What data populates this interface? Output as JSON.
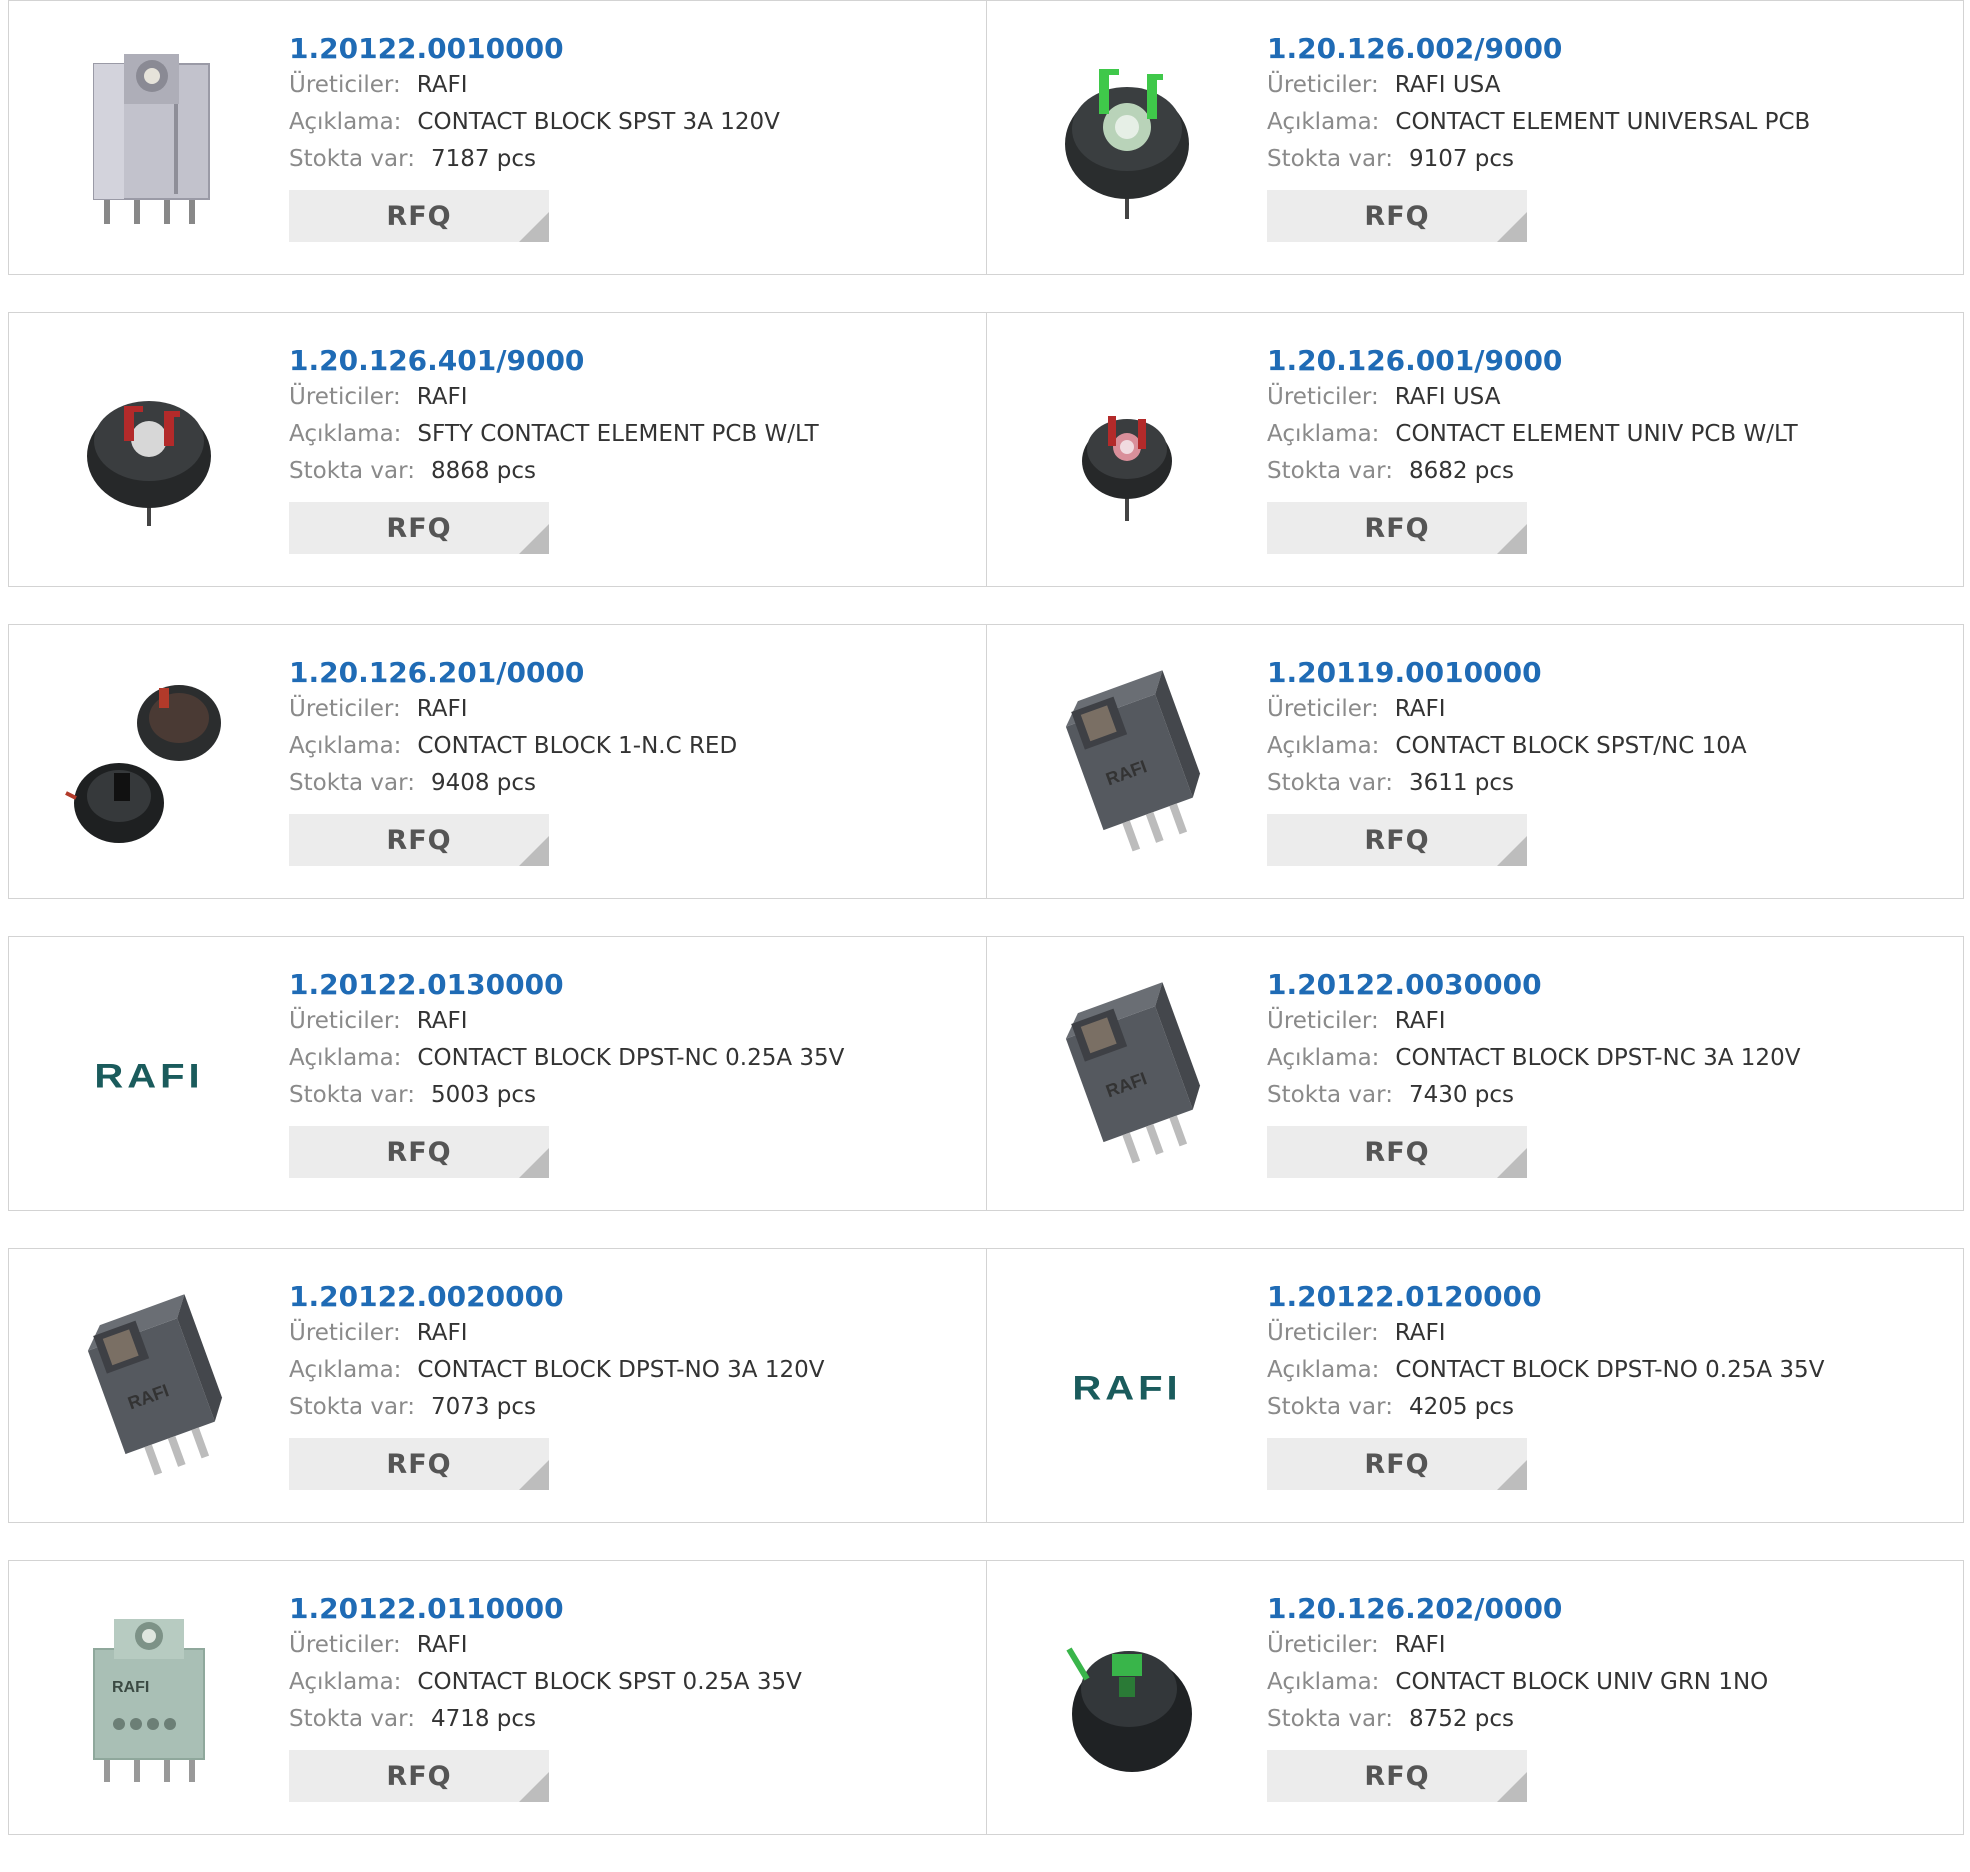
{
  "labels": {
    "manufacturer": "Üreticiler:",
    "description": "Açıklama:",
    "stock": "Stokta var:",
    "rfq": "RFQ"
  },
  "colors": {
    "part_number": "#1f6bb5",
    "rafi_logo": "#1a5b5c",
    "rfq_bg": "#ececec",
    "border": "#d3d3d3"
  },
  "products": [
    {
      "part": "1.20122.0010000",
      "manufacturer": "RAFI",
      "description": "CONTACT BLOCK SPST 3A 120V",
      "stock": "7187 pcs",
      "image": "gray-block-icon"
    },
    {
      "part": "1.20.126.002/9000",
      "manufacturer": "RAFI USA",
      "description": "CONTACT ELEMENT UNIVERSAL PCB",
      "stock": "9107 pcs",
      "image": "round-element-green-icon"
    },
    {
      "part": "1.20.126.401/9000",
      "manufacturer": "RAFI",
      "description": "SFTY CONTACT ELEMENT PCB W/LT",
      "stock": "8868 pcs",
      "image": "round-element-red-icon"
    },
    {
      "part": "1.20.126.001/9000",
      "manufacturer": "RAFI USA",
      "description": "CONTACT ELEMENT UNIV PCB W/LT",
      "stock": "8682 pcs",
      "image": "round-element-red-small-icon"
    },
    {
      "part": "1.20.126.201/0000",
      "manufacturer": "RAFI",
      "description": "CONTACT BLOCK 1-N.C RED",
      "stock": "9408 pcs",
      "image": "two-round-elements-icon"
    },
    {
      "part": "1.20119.0010000",
      "manufacturer": "RAFI",
      "description": "CONTACT BLOCK SPST/NC 10A",
      "stock": "3611 pcs",
      "image": "dark-block-icon"
    },
    {
      "part": "1.20122.0130000",
      "manufacturer": "RAFI",
      "description": "CONTACT BLOCK DPST-NC 0.25A 35V",
      "stock": "5003 pcs",
      "image": "rafi-logo",
      "logo_text": "RAFI"
    },
    {
      "part": "1.20122.0030000",
      "manufacturer": "RAFI",
      "description": "CONTACT BLOCK DPST-NC 3A 120V",
      "stock": "7430 pcs",
      "image": "dark-block-icon"
    },
    {
      "part": "1.20122.0020000",
      "manufacturer": "RAFI",
      "description": "CONTACT BLOCK DPST-NO 3A 120V",
      "stock": "7073 pcs",
      "image": "dark-block-icon"
    },
    {
      "part": "1.20122.0120000",
      "manufacturer": "RAFI",
      "description": "CONTACT BLOCK DPST-NO 0.25A 35V",
      "stock": "4205 pcs",
      "image": "rafi-logo",
      "logo_text": "RAFI"
    },
    {
      "part": "1.20122.0110000",
      "manufacturer": "RAFI",
      "description": "CONTACT BLOCK SPST 0.25A 35V",
      "stock": "4718 pcs",
      "image": "light-green-block-icon"
    },
    {
      "part": "1.20.126.202/0000",
      "manufacturer": "RAFI",
      "description": "CONTACT BLOCK UNIV GRN 1NO",
      "stock": "8752 pcs",
      "image": "round-element-green-small-icon"
    }
  ]
}
